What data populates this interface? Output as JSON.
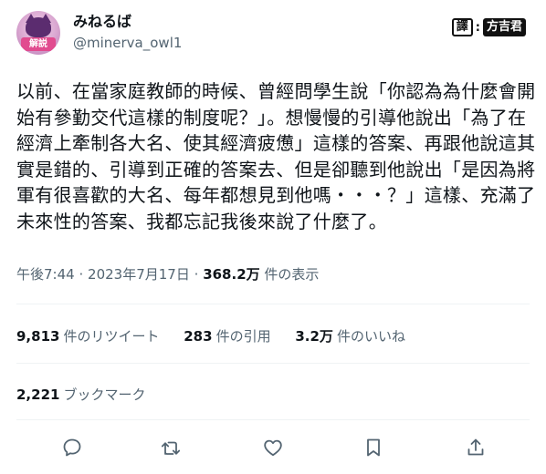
{
  "author": {
    "display_name": "みねるば",
    "handle": "@minerva_owl1",
    "avatar_badge": "解説"
  },
  "translator": {
    "label": "譯",
    "separator": ":",
    "name": "方吉君"
  },
  "tweet": {
    "text_lines": [
      "以前、在當家庭教師的時候、曾經問學生說「你認為為什麼會開",
      "始有參勤交代這樣的制度呢？」。想慢慢的引導他說出「為了在",
      "經濟上牽制各大名、使其經濟疲憊」這樣的答案、再跟他說這其",
      "實是錯的、引導到正確的答案去、但是卻聽到他說出「是因為將",
      "軍有很喜歡的大名、每年都想見到他嗎・・・？」這樣、充滿了",
      "未來性的答案、我都忘記我後來說了什麼了。"
    ]
  },
  "meta": {
    "time": "午後7:44",
    "date": "2023年7月17日",
    "separator": "·",
    "views_count": "368.2万",
    "views_label": "件の表示"
  },
  "stats": [
    {
      "count": "9,813",
      "label": "件のリツイート"
    },
    {
      "count": "283",
      "label": "件の引用"
    },
    {
      "count": "3.2万",
      "label": "件のいいね"
    }
  ],
  "bookmarks": {
    "count": "2,221",
    "label": "ブックマーク"
  },
  "actions": [
    {
      "icon": "reply-icon"
    },
    {
      "icon": "retweet-icon"
    },
    {
      "icon": "like-icon"
    },
    {
      "icon": "bookmark-icon"
    },
    {
      "icon": "share-icon"
    }
  ],
  "colors": {
    "text": "#0f1419",
    "secondary": "#536471",
    "divider": "#eff3f4",
    "icon": "#536471"
  }
}
